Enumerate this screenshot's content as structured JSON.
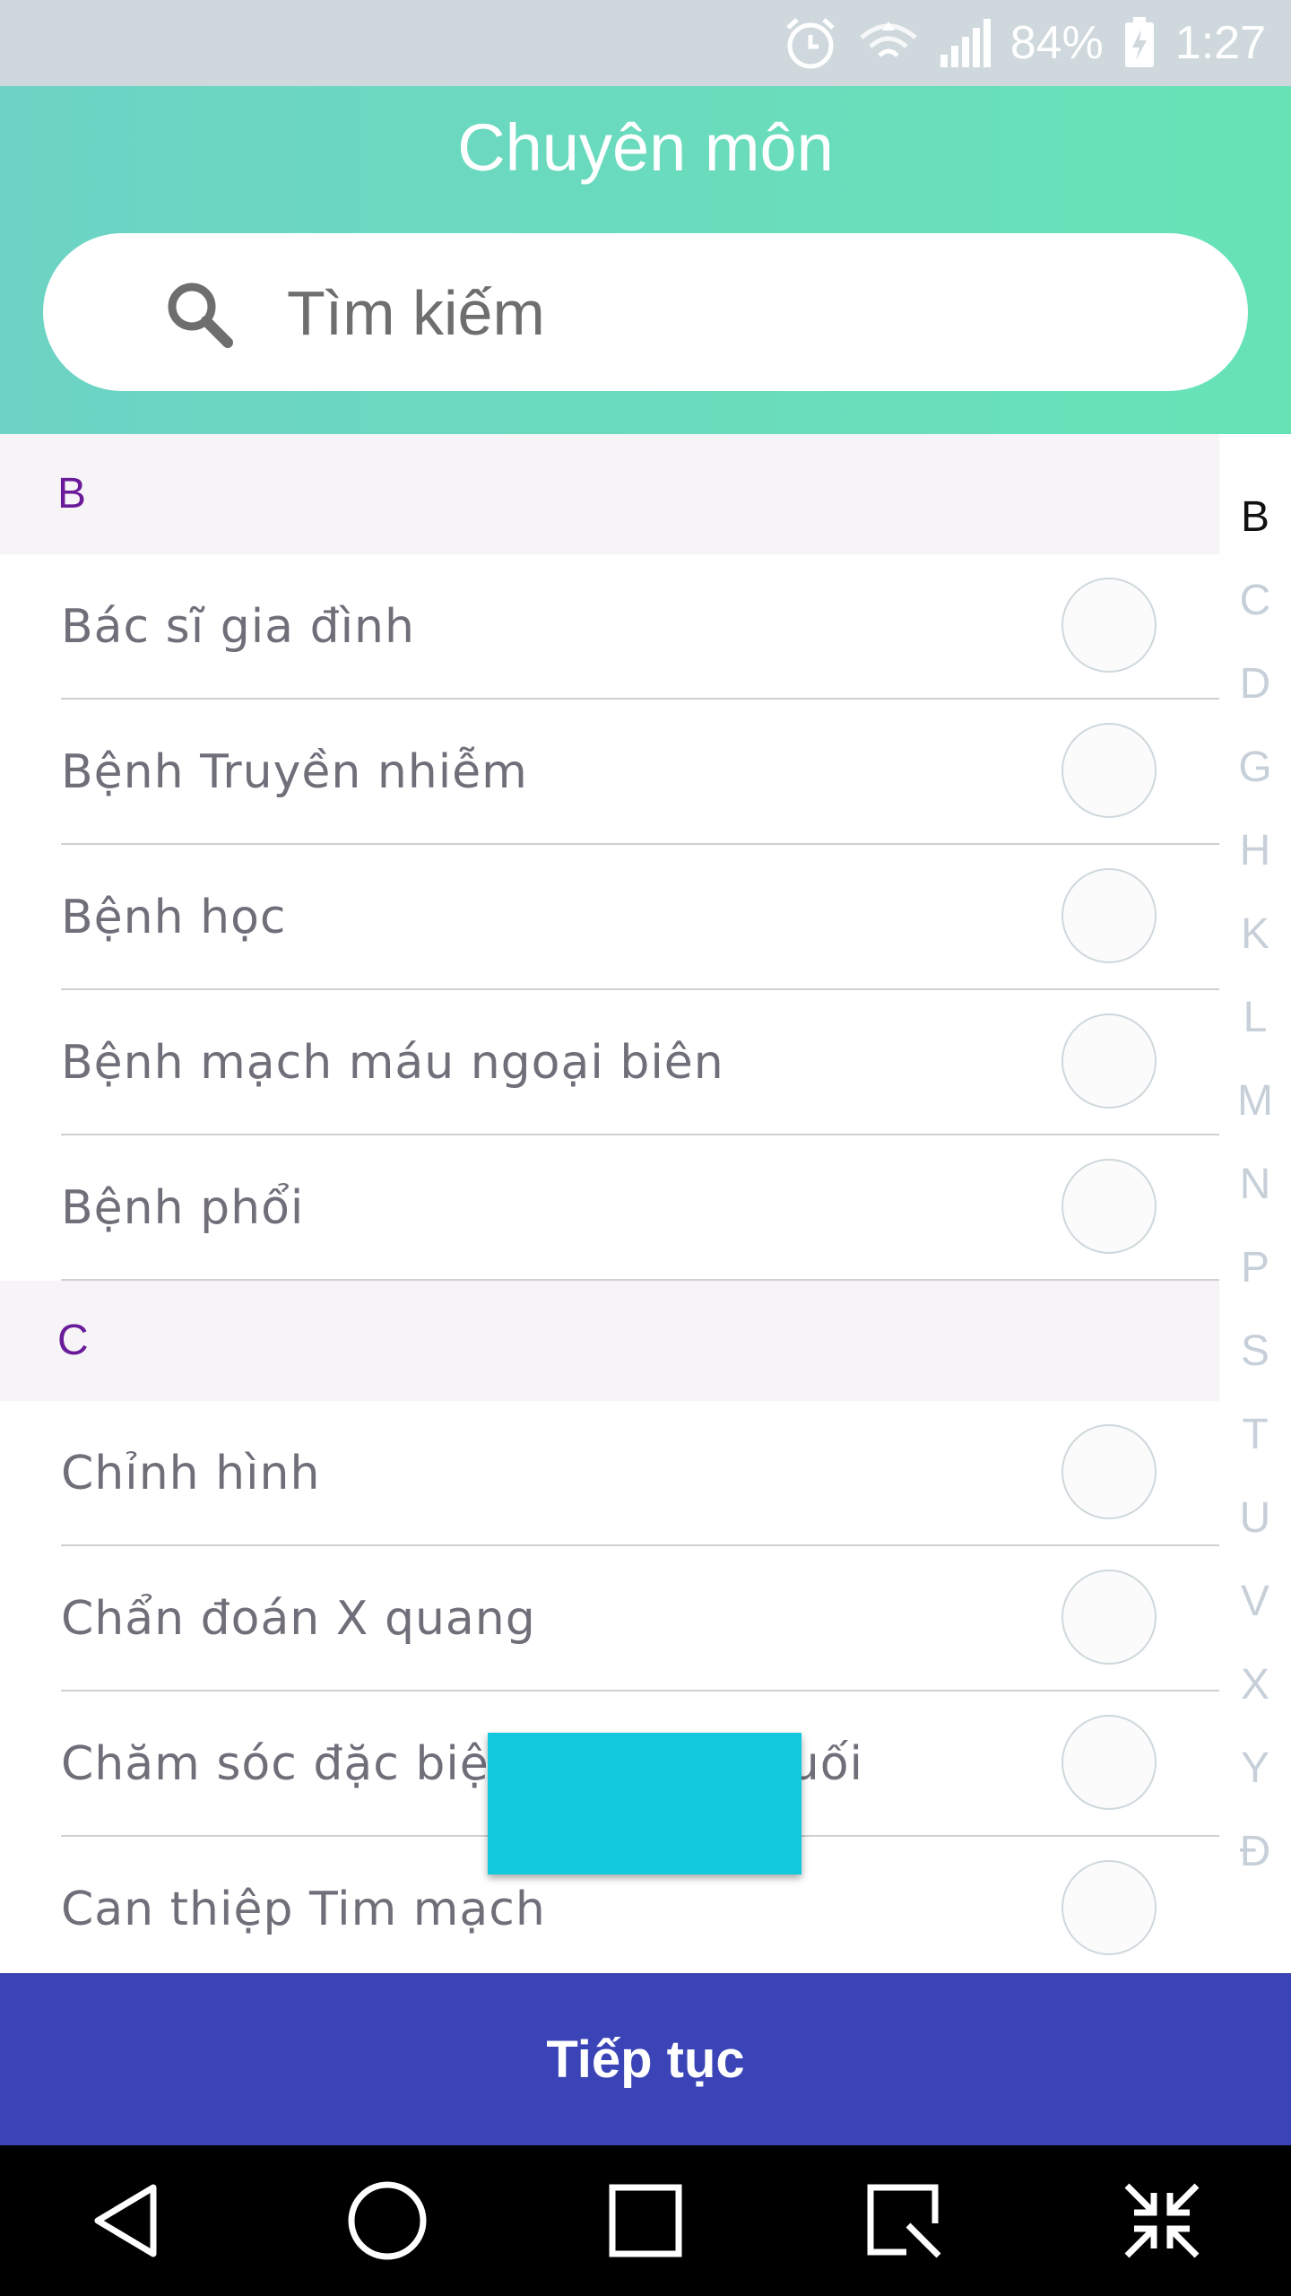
{
  "status_bar": {
    "battery": "84%",
    "time": "1:27",
    "icons": [
      "alarm-icon",
      "wifi-icon",
      "signal-icon",
      "battery-charging-icon"
    ]
  },
  "header": {
    "title": "Chuyên môn",
    "search_placeholder": "Tìm kiếm"
  },
  "sections": [
    {
      "letter": "B",
      "items": [
        {
          "label": "Bác sĩ gia đình"
        },
        {
          "label": "Bệnh Truyền nhiễm"
        },
        {
          "label": "Bệnh học"
        },
        {
          "label": "Bệnh mạch máu ngoại biên"
        },
        {
          "label": "Bệnh phổi"
        }
      ]
    },
    {
      "letter": "C",
      "items": [
        {
          "label": "Chỉnh hình"
        },
        {
          "label": "Chẩn đoán X quang"
        },
        {
          "label": "Chăm sóc đặc biệt giai đoạn cuối"
        },
        {
          "label": "Can thiệp Tim mạch"
        }
      ]
    }
  ],
  "index_letters": [
    "B",
    "C",
    "D",
    "G",
    "H",
    "K",
    "L",
    "M",
    "N",
    "P",
    "S",
    "T",
    "U",
    "V",
    "X",
    "Y",
    "Đ"
  ],
  "active_index": "B",
  "continue_label": "Tiếp tục",
  "colors": {
    "header_gradient_start": "#6dd3c5",
    "header_gradient_end": "#67e3b6",
    "section_letter": "#6a1b9a",
    "continue_button": "#3a44b6",
    "toast": "#11c8dc"
  }
}
